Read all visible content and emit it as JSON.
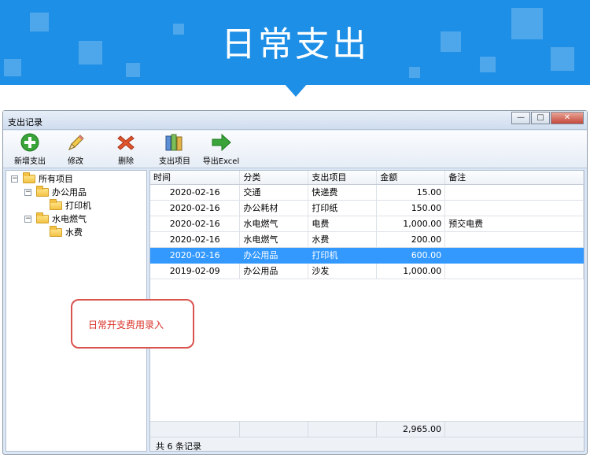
{
  "banner": {
    "title": "日常支出"
  },
  "window": {
    "title": "支出记录",
    "buttons": {
      "minimize": "—",
      "maximize": "□",
      "close": "✕"
    }
  },
  "toolbar": {
    "items": [
      {
        "label": "新增支出",
        "icon": "add-icon"
      },
      {
        "label": "修改",
        "icon": "pencil-icon"
      },
      {
        "label": "删除",
        "icon": "delete-icon"
      },
      {
        "label": "支出项目",
        "icon": "books-icon"
      },
      {
        "label": "导出Excel",
        "icon": "export-arrow-icon"
      }
    ]
  },
  "tree": {
    "root": {
      "label": "所有项目",
      "toggle": "−"
    },
    "groups": [
      {
        "label": "办公用品",
        "toggle": "−",
        "children": [
          "打印机"
        ]
      },
      {
        "label": "水电燃气",
        "toggle": "−",
        "children": [
          "水费"
        ]
      }
    ]
  },
  "grid": {
    "columns": [
      "时间",
      "分类",
      "支出项目",
      "金额",
      "备注"
    ],
    "rows": [
      {
        "date": "2020-02-16",
        "category": "交通",
        "item": "快递费",
        "amount": "15.00",
        "note": ""
      },
      {
        "date": "2020-02-16",
        "category": "办公耗材",
        "item": "打印纸",
        "amount": "150.00",
        "note": ""
      },
      {
        "date": "2020-02-16",
        "category": "水电燃气",
        "item": "电费",
        "amount": "1,000.00",
        "note": "预交电费"
      },
      {
        "date": "2020-02-16",
        "category": "水电燃气",
        "item": "水费",
        "amount": "200.00",
        "note": ""
      },
      {
        "date": "2020-02-16",
        "category": "办公用品",
        "item": "打印机",
        "amount": "600.00",
        "note": ""
      },
      {
        "date": "2019-02-09",
        "category": "办公用品",
        "item": "沙发",
        "amount": "1,000.00",
        "note": ""
      }
    ],
    "selected_index": 4,
    "total": "2,965.00",
    "status": "共 6 条记录"
  },
  "callout": {
    "text": "日常开支费用录入"
  },
  "colors": {
    "banner": "#1e8fe6",
    "selection": "#3399ff",
    "callout_border": "#d9534f"
  }
}
